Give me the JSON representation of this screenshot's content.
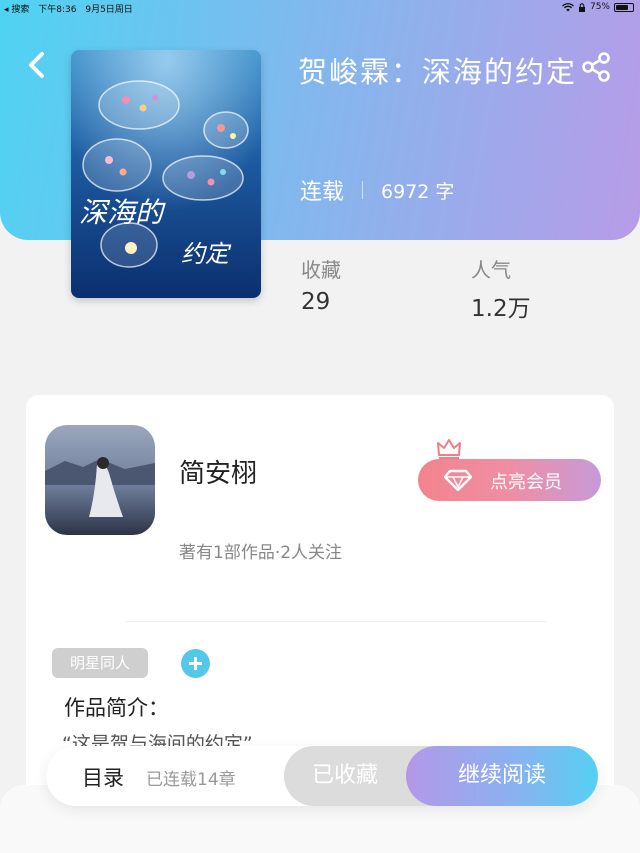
{
  "status_bar": {
    "back_app": "◂ 搜索",
    "time": "下午8:36",
    "date": "9月5日周日",
    "battery": "75%",
    "battery_level": 0.75
  },
  "book": {
    "title": "贺峻霖：深海的约定",
    "status": "连载",
    "word_count": "6972 字",
    "cover_text_1": "深海的",
    "cover_text_2": "约定"
  },
  "stats": {
    "favorites_label": "收藏",
    "favorites_value": "29",
    "popularity_label": "人气",
    "popularity_value": "1.2万"
  },
  "author": {
    "name": "简安栩",
    "meta": "著有1部作品·2人关注",
    "vip_label": "点亮会员"
  },
  "work": {
    "tag": "明星同人",
    "intro_label": "作品简介：",
    "intro_text": "“这是贺与海间的约定”"
  },
  "bottom_bar": {
    "toc_label": "目录",
    "chapters_label": "已连载14章",
    "collected_label": "已收藏",
    "read_label": "继续阅读"
  },
  "icons": {
    "back": "back-chevron-icon",
    "share": "share-icon",
    "vip": "diamond-icon",
    "crown": "crown-icon",
    "add": "plus-icon"
  },
  "colors": {
    "header_gradient": [
      "#4fd3f2",
      "#b79ce8"
    ],
    "vip_gradient": [
      "#f2848d",
      "#c79ad8"
    ],
    "read_gradient": [
      "#b398e8",
      "#55d0f2"
    ],
    "accent": "#55c8ea"
  }
}
